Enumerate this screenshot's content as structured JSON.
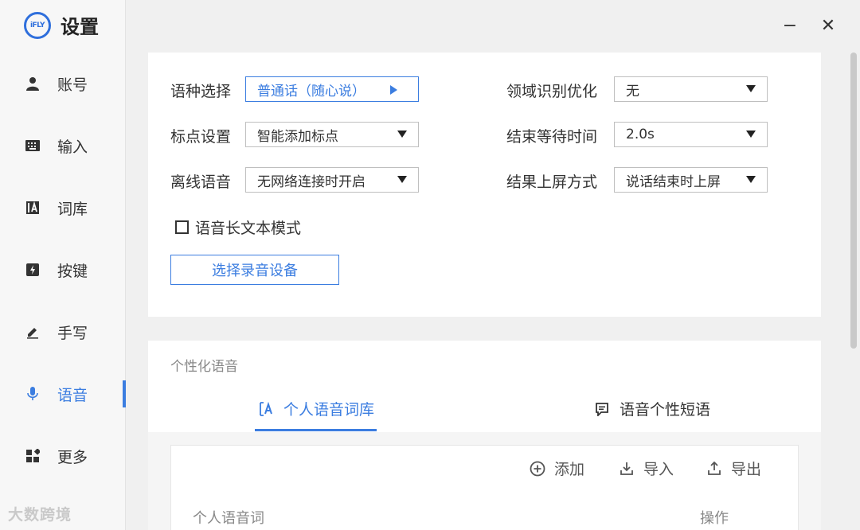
{
  "app": {
    "logo_text": "iFLY",
    "title": "设置"
  },
  "window": {
    "minimize_symbol": "−",
    "close_symbol": "✕"
  },
  "sidebar": {
    "items": [
      {
        "label": "账号",
        "icon": "user-icon"
      },
      {
        "label": "输入",
        "icon": "keyboard-icon"
      },
      {
        "label": "词库",
        "icon": "dictionary-icon"
      },
      {
        "label": "按键",
        "icon": "key-icon"
      },
      {
        "label": "手写",
        "icon": "pen-icon"
      },
      {
        "label": "语音",
        "icon": "microphone-icon",
        "active": true
      },
      {
        "label": "更多",
        "icon": "apps-icon"
      }
    ]
  },
  "voice_settings": {
    "language_label": "语种选择",
    "language_value": "普通话（随心说）",
    "domain_label": "领域识别优化",
    "domain_value": "无",
    "punctuation_label": "标点设置",
    "punctuation_value": "智能添加标点",
    "wait_label": "结束等待时间",
    "wait_value": "2.0s",
    "offline_label": "离线语音",
    "offline_value": "无网络连接时开启",
    "commit_label": "结果上屏方式",
    "commit_value": "说话结束时上屏",
    "long_text_label": "语音长文本模式",
    "long_text_checked": false,
    "device_button": "选择录音设备"
  },
  "personal": {
    "section_title": "个性化语音",
    "tabs": [
      {
        "label": "个人语音词库",
        "icon": "dictionary-icon",
        "active": true
      },
      {
        "label": "语音个性短语",
        "icon": "note-icon",
        "active": false
      }
    ],
    "actions": {
      "add": "添加",
      "import": "导入",
      "export": "导出"
    },
    "columns": {
      "word": "个人语音词",
      "ops": "操作"
    }
  },
  "watermark": "大数跨境",
  "colors": {
    "accent": "#3b7de0"
  }
}
